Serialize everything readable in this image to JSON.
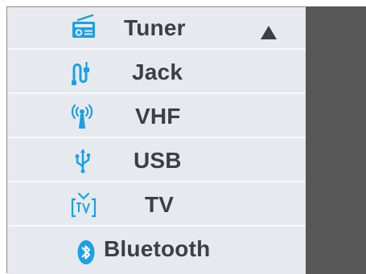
{
  "menu": {
    "items": [
      {
        "label": "Tuner",
        "icon": "radio-icon"
      },
      {
        "label": "Jack",
        "icon": "jack-cable-icon"
      },
      {
        "label": "VHF",
        "icon": "antenna-icon"
      },
      {
        "label": "USB",
        "icon": "usb-icon"
      },
      {
        "label": "TV",
        "icon": "tv-icon"
      },
      {
        "label": "Bluetooth",
        "icon": "bluetooth-icon"
      }
    ],
    "selected_index": 0,
    "expand_indicator": "collapse-arrow-icon"
  },
  "colors": {
    "menu_background": "#e6eaee",
    "separator": "#f6f8fb",
    "text": "#3b3f46",
    "icon_blue": "#1aa0e5",
    "right_panel": "#575757"
  }
}
